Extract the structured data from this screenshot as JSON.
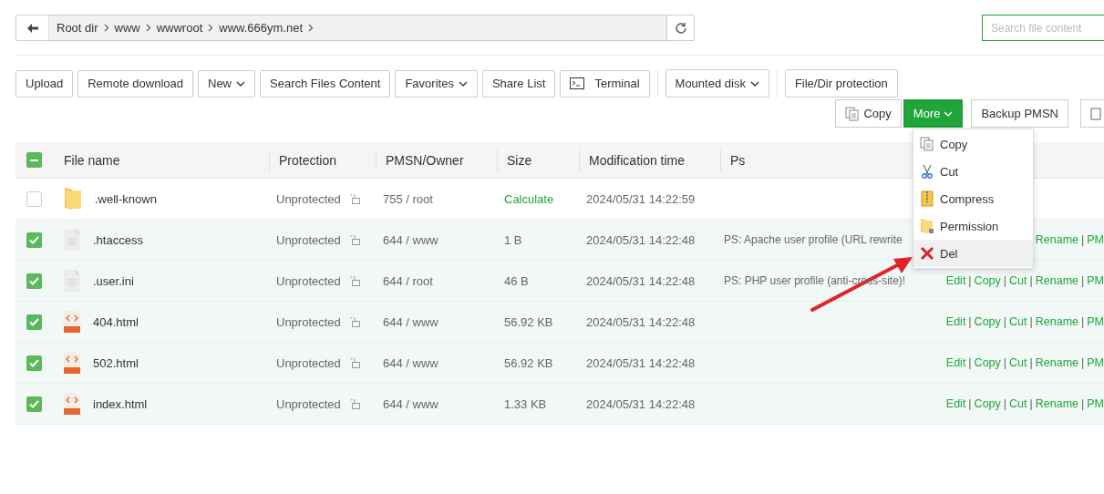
{
  "breadcrumb": {
    "segments": [
      "Root dir",
      "www",
      "wwwroot",
      "www.666ym.net"
    ]
  },
  "search": {
    "placeholder": "Search file content"
  },
  "toolbar": [
    {
      "label": "Upload",
      "dropdown": false,
      "kind": "plain"
    },
    {
      "label": "Remote download",
      "dropdown": false,
      "kind": "plain"
    },
    {
      "label": "New",
      "dropdown": true,
      "kind": "plain"
    },
    {
      "label": "Search Files Content",
      "dropdown": false,
      "kind": "plain"
    },
    {
      "label": "Favorites",
      "dropdown": true,
      "kind": "plain"
    },
    {
      "label": "Share List",
      "dropdown": false,
      "kind": "plain"
    },
    {
      "label": "Terminal",
      "dropdown": false,
      "kind": "terminal"
    },
    {
      "label": "Mounted disk",
      "dropdown": true,
      "kind": "separated"
    },
    {
      "label": "File/Dir protection",
      "dropdown": false,
      "kind": "separated"
    }
  ],
  "selection_toolbar": [
    {
      "label": "Copy",
      "kind": "copy",
      "open": false
    },
    {
      "label": "More",
      "kind": "more",
      "open": true
    },
    {
      "label": "Backup PMSN",
      "kind": "plain",
      "open": false
    },
    {
      "kind": "icon",
      "open": false
    }
  ],
  "more_menu": [
    {
      "label": "Copy",
      "kind": "copy",
      "hovered": false
    },
    {
      "label": "Cut",
      "kind": "cut",
      "hovered": false
    },
    {
      "label": "Compress",
      "kind": "compress",
      "hovered": false
    },
    {
      "label": "Permission",
      "kind": "permission",
      "hovered": false
    },
    {
      "label": "Del",
      "kind": "del",
      "hovered": true
    }
  ],
  "table": {
    "select_all": {
      "indeterminate": true
    },
    "columns": [
      "File name",
      "Protection",
      "PMSN/Owner",
      "Size",
      "Modification time",
      "Ps"
    ],
    "rows": [
      {
        "checked": false,
        "kind": "folder",
        "name": ".well-known",
        "protection": "Unprotected",
        "pmsn": "755 / root",
        "size": "Calculate",
        "size_is_link": true,
        "modified": "2024/05/31 14:22:59",
        "operations": []
      },
      {
        "checked": true,
        "kind": "text",
        "name": ".htaccess",
        "protection": "Unprotected",
        "pmsn": "644 / www",
        "size": "1 B",
        "size_is_link": false,
        "modified": "2024/05/31 14:22:48",
        "ps": "PS: Apache user profile (URL rewrite",
        "operations": [
          {
            "kind": "link",
            "label": "Rename"
          },
          {
            "kind": "separator",
            "label": "|"
          },
          {
            "kind": "link",
            "label": "PM"
          }
        ]
      },
      {
        "checked": true,
        "kind": "text",
        "name": ".user.ini",
        "protection": "Unprotected",
        "pmsn": "644 / root",
        "size": "46 B",
        "size_is_link": false,
        "modified": "2024/05/31 14:22:48",
        "ps": "PS: PHP user profile (anti-cross-site)!",
        "operations": [
          {
            "kind": "link",
            "label": "Edit"
          },
          {
            "kind": "separator",
            "label": "|"
          },
          {
            "kind": "link",
            "label": "Copy"
          },
          {
            "kind": "separator",
            "label": "|"
          },
          {
            "kind": "link",
            "label": "Cut"
          },
          {
            "kind": "separator",
            "label": "|"
          },
          {
            "kind": "link",
            "label": "Rename"
          },
          {
            "kind": "separator",
            "label": "|"
          },
          {
            "kind": "link",
            "label": "PM"
          }
        ]
      },
      {
        "checked": true,
        "kind": "html",
        "name": "404.html",
        "protection": "Unprotected",
        "pmsn": "644 / www",
        "size": "56.92 KB",
        "size_is_link": false,
        "modified": "2024/05/31 14:22:48",
        "operations": [
          {
            "kind": "link",
            "label": "Edit"
          },
          {
            "kind": "separator",
            "label": "|"
          },
          {
            "kind": "link",
            "label": "Copy"
          },
          {
            "kind": "separator",
            "label": "|"
          },
          {
            "kind": "link",
            "label": "Cut"
          },
          {
            "kind": "separator",
            "label": "|"
          },
          {
            "kind": "link",
            "label": "Rename"
          },
          {
            "kind": "separator",
            "label": "|"
          },
          {
            "kind": "link",
            "label": "PM"
          }
        ]
      },
      {
        "checked": true,
        "kind": "html",
        "name": "502.html",
        "protection": "Unprotected",
        "pmsn": "644 / www",
        "size": "56.92 KB",
        "size_is_link": false,
        "modified": "2024/05/31 14:22:48",
        "operations": [
          {
            "kind": "link",
            "label": "Edit"
          },
          {
            "kind": "separator",
            "label": "|"
          },
          {
            "kind": "link",
            "label": "Copy"
          },
          {
            "kind": "separator",
            "label": "|"
          },
          {
            "kind": "link",
            "label": "Cut"
          },
          {
            "kind": "separator",
            "label": "|"
          },
          {
            "kind": "link",
            "label": "Rename"
          },
          {
            "kind": "separator",
            "label": "|"
          },
          {
            "kind": "link",
            "label": "PM"
          }
        ]
      },
      {
        "checked": true,
        "kind": "html",
        "name": "index.html",
        "protection": "Unprotected",
        "pmsn": "644 / www",
        "size": "1.33 KB",
        "size_is_link": false,
        "modified": "2024/05/31 14:22:48",
        "operations": [
          {
            "kind": "link",
            "label": "Edit"
          },
          {
            "kind": "separator",
            "label": "|"
          },
          {
            "kind": "link",
            "label": "Copy"
          },
          {
            "kind": "separator",
            "label": "|"
          },
          {
            "kind": "link",
            "label": "Cut"
          },
          {
            "kind": "separator",
            "label": "|"
          },
          {
            "kind": "link",
            "label": "Rename"
          },
          {
            "kind": "separator",
            "label": "|"
          },
          {
            "kind": "link",
            "label": "PM"
          }
        ]
      }
    ]
  }
}
